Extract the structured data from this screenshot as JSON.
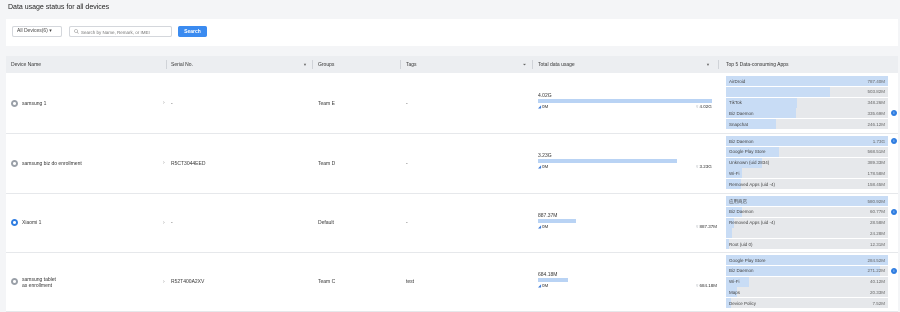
{
  "page": {
    "title": "Data usage status for all devices"
  },
  "filters": {
    "device_select": "All Devices(6) ▾",
    "search_placeholder": "Search by Name, Remark, or IMEI",
    "search_button": "Search"
  },
  "table": {
    "headers": {
      "device_name": "Device Name",
      "serial_no": "Serial No.",
      "groups": "Groups",
      "tags": "Tags",
      "total_usage": "Total data usage",
      "top_apps": "Top 5 Data-consuming Apps"
    },
    "rows": [
      {
        "name": "samsung 1",
        "serial": "-",
        "group": "Team E",
        "tags": "-",
        "total": "4.02G",
        "usage_fraction": 1.0,
        "up": "0M",
        "down": "4.02G",
        "icon": "android-device-icon",
        "apps": [
          {
            "name": "AirDroid",
            "value": "787.40M",
            "fraction": 1.0,
            "info": false
          },
          {
            "name": "",
            "value": "503.82M",
            "fraction": 0.64,
            "info": false
          },
          {
            "name": "TikTok",
            "value": "348.26M",
            "fraction": 0.44,
            "info": false
          },
          {
            "name": "Biz Daemon",
            "value": "335.69M",
            "fraction": 0.43,
            "info": true
          },
          {
            "name": "Snapchat",
            "value": "246.12M",
            "fraction": 0.31,
            "info": false
          }
        ]
      },
      {
        "name": "samsung biz do enrollment",
        "serial": "R5CT3044EED",
        "group": "Team D",
        "tags": "-",
        "total": "3.23G",
        "usage_fraction": 0.8,
        "up": "0M",
        "down": "3.23G",
        "icon": "android-device-icon",
        "apps": [
          {
            "name": "Biz Daemon",
            "value": "1.73G",
            "fraction": 1.0,
            "info": true
          },
          {
            "name": "Google Play Store",
            "value": "568.51M",
            "fraction": 0.33,
            "info": false
          },
          {
            "name": "Unknown (uid 2834)",
            "value": "389.33M",
            "fraction": 0.22,
            "info": false
          },
          {
            "name": "Wi-Fi",
            "value": "178.58M",
            "fraction": 0.1,
            "info": false
          },
          {
            "name": "Removed Apps (uid -4)",
            "value": "158.45M",
            "fraction": 0.09,
            "info": false
          }
        ]
      },
      {
        "name": "Xiaomi 1",
        "serial": "-",
        "group": "Default",
        "tags": "-",
        "total": "887.37M",
        "usage_fraction": 0.22,
        "up": "0M",
        "down": "887.37M",
        "icon": "android-device-icon",
        "apps": [
          {
            "name": "应用商店",
            "value": "580.92M",
            "fraction": 1.0,
            "info": false
          },
          {
            "name": "Biz Daemon",
            "value": "60.77M",
            "fraction": 0.1,
            "info": true
          },
          {
            "name": "Removed Apps (uid -4)",
            "value": "28.58M",
            "fraction": 0.05,
            "info": false
          },
          {
            "name": "",
            "value": "24.28M",
            "fraction": 0.04,
            "info": false
          },
          {
            "name": "Root (uid 0)",
            "value": "12.31M",
            "fraction": 0.02,
            "info": false
          }
        ]
      },
      {
        "name": "samsung tablet\nas enrollment",
        "serial": "R52T400A2XV",
        "group": "Team C",
        "tags": "test",
        "total": "684.18M",
        "usage_fraction": 0.17,
        "up": "0M",
        "down": "684.18M",
        "icon": "android-device-icon",
        "apps": [
          {
            "name": "Google Play Store",
            "value": "284.52M",
            "fraction": 1.0,
            "info": false
          },
          {
            "name": "Biz Daemon",
            "value": "271.22M",
            "fraction": 0.95,
            "info": true
          },
          {
            "name": "Wi-Fi",
            "value": "40.12M",
            "fraction": 0.14,
            "info": false
          },
          {
            "name": "Maps",
            "value": "20.33M",
            "fraction": 0.07,
            "info": false
          },
          {
            "name": "Device Policy",
            "value": "7.52M",
            "fraction": 0.03,
            "info": false
          }
        ]
      }
    ]
  }
}
